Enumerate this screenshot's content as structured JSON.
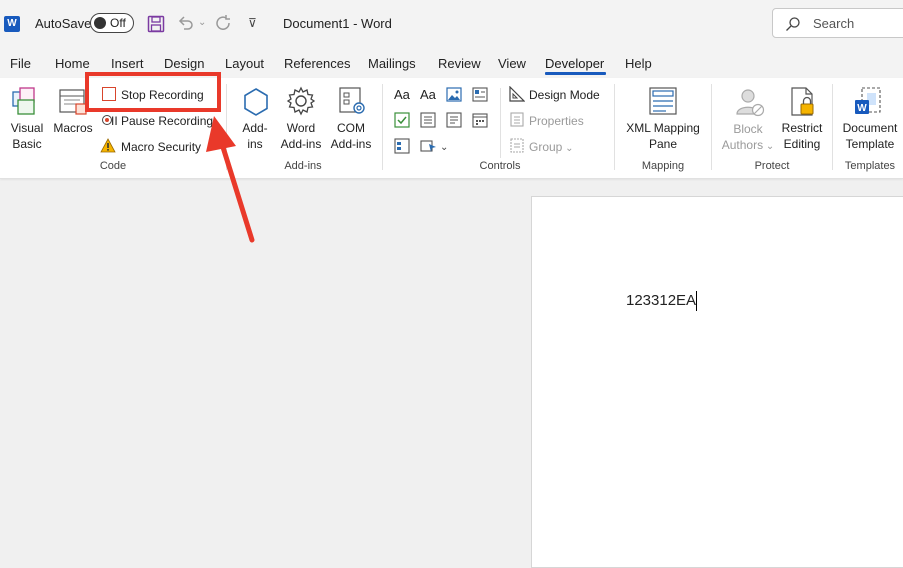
{
  "titlebar": {
    "autosave_label": "AutoSave",
    "autosave_state": "Off",
    "document_title": "Document1 - Word",
    "search_placeholder": "Search"
  },
  "menu": {
    "tabs": [
      "File",
      "Home",
      "Insert",
      "Design",
      "Layout",
      "References",
      "Mailings",
      "Review",
      "View",
      "Developer",
      "Help"
    ],
    "active": "Developer"
  },
  "ribbon": {
    "code": {
      "visual_basic": [
        "Visual",
        "Basic"
      ],
      "macros": "Macros",
      "stop_recording": "Stop Recording",
      "pause_recording": "II Pause Recording",
      "macro_security": "Macro Security",
      "label": "Code"
    },
    "addins": {
      "addins": [
        "Add-",
        "ins"
      ],
      "word_addins": [
        "Word",
        "Add-ins"
      ],
      "com_addins": [
        "COM",
        "Add-ins"
      ],
      "label": "Add-ins"
    },
    "controls": {
      "design_mode": "Design Mode",
      "properties": "Properties",
      "group": "Group",
      "label": "Controls"
    },
    "mapping": {
      "xml_mapping": [
        "XML Mapping",
        "Pane"
      ],
      "label": "Mapping"
    },
    "protect": {
      "block_authors": [
        "Block",
        "Authors"
      ],
      "restrict_editing": [
        "Restrict",
        "Editing"
      ],
      "label": "Protect"
    },
    "templates": {
      "document_template": [
        "Document",
        "Template"
      ],
      "label": "Templates"
    }
  },
  "document": {
    "text": "123312EA"
  },
  "colors": {
    "accent": "#185abd",
    "annotation": "#e9392a"
  }
}
